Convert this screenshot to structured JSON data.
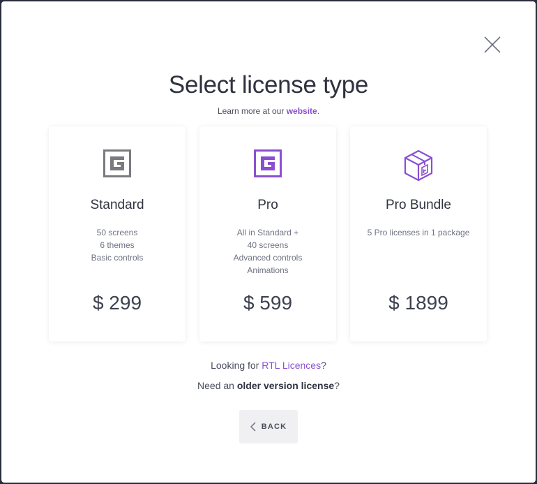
{
  "dialog": {
    "title": "Select license type",
    "subtitle_prefix": "Learn more at our",
    "subtitle_link": "website",
    "subtitle_suffix": "."
  },
  "cards": [
    {
      "name": "Standard",
      "icon": "logo-icon-grey",
      "features": [
        "50 screens",
        "6 themes",
        "Basic controls"
      ],
      "price": "$ 299"
    },
    {
      "name": "Pro",
      "icon": "logo-icon-purple",
      "features": [
        "All in Standard +",
        "40 screens",
        "Advanced controls",
        "Animations"
      ],
      "price": "$ 599"
    },
    {
      "name": "Pro Bundle",
      "icon": "package-box-icon",
      "features": [
        "5 Pro licenses in 1 package"
      ],
      "price": "$ 1899"
    }
  ],
  "rtl": {
    "prefix": "Looking for",
    "link": "RTL Licences",
    "suffix": "?"
  },
  "older": {
    "prefix": "Need an",
    "link": "older version license",
    "suffix": "?"
  },
  "back_label": "BACK",
  "colors": {
    "accent": "#8a4fd0",
    "grey_icon": "#7a7a80",
    "text_dark": "#2f3340"
  }
}
